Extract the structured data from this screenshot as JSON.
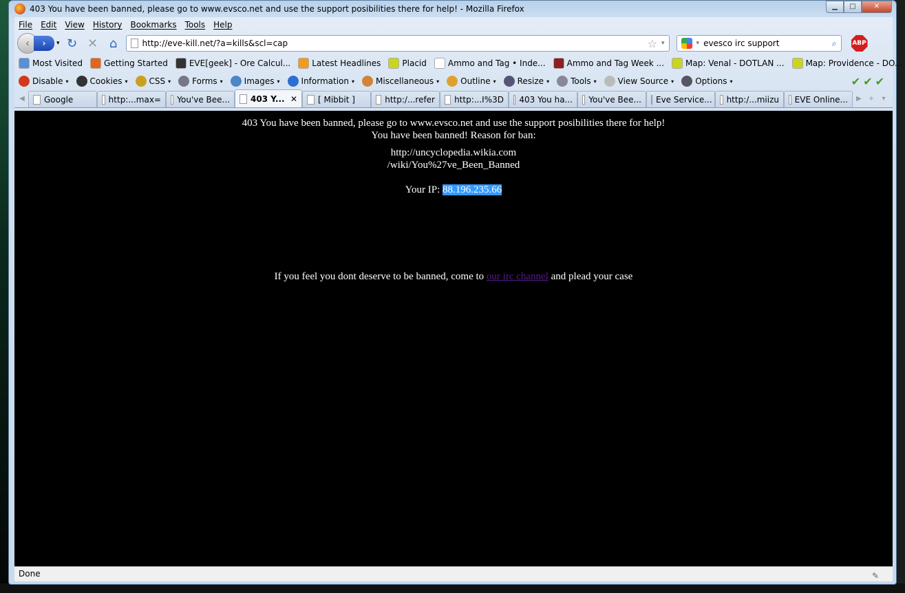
{
  "window": {
    "title": "403 You have been banned, please go to www.evsco.net and use the support posibilities there for help! - Mozilla Firefox"
  },
  "menu": [
    "File",
    "Edit",
    "View",
    "History",
    "Bookmarks",
    "Tools",
    "Help"
  ],
  "nav": {
    "url": "http://eve-kill.net/?a=kills&scl=cap",
    "search_value": "evesco irc support",
    "abp": "ABP"
  },
  "bookmarks": [
    {
      "label": "Most Visited",
      "icon": "search-page-icon",
      "color": "#5a8fd8"
    },
    {
      "label": "Getting Started",
      "icon": "firefox-icon",
      "color": "#e2651c"
    },
    {
      "label": "EVE[geek] - Ore Calcul...",
      "icon": "menu-lines-icon",
      "color": "#333"
    },
    {
      "label": "Latest Headlines",
      "icon": "rss-icon",
      "color": "#f29c1e"
    },
    {
      "label": "Placid",
      "icon": "dotlan-icon",
      "color": "#c8d61e"
    },
    {
      "label": "Ammo and Tag • Inde...",
      "icon": "page-icon",
      "color": "#fff"
    },
    {
      "label": "Ammo and Tag Week ...",
      "icon": "eve-icon",
      "color": "#8a2020"
    },
    {
      "label": "Map: Venal - DOTLAN ...",
      "icon": "dotlan-icon",
      "color": "#c8d61e"
    },
    {
      "label": "Map: Providence - DO...",
      "icon": "dotlan-icon",
      "color": "#c8d61e"
    }
  ],
  "bookmarks_overflow": "»",
  "devtools": [
    {
      "label": "Disable",
      "icon": "disable-icon",
      "color": "#d13b1b"
    },
    {
      "label": "Cookies",
      "icon": "user-icon",
      "color": "#333"
    },
    {
      "label": "CSS",
      "icon": "wand-icon",
      "color": "#c9a11e"
    },
    {
      "label": "Forms",
      "icon": "form-icon",
      "color": "#778"
    },
    {
      "label": "Images",
      "icon": "image-icon",
      "color": "#4a86c8"
    },
    {
      "label": "Information",
      "icon": "info-icon",
      "color": "#2a6fd1"
    },
    {
      "label": "Miscellaneous",
      "icon": "toolbox-icon",
      "color": "#d0843a"
    },
    {
      "label": "Outline",
      "icon": "pencil-icon",
      "color": "#e0a030"
    },
    {
      "label": "Resize",
      "icon": "resize-icon",
      "color": "#557"
    },
    {
      "label": "Tools",
      "icon": "tools-icon",
      "color": "#889"
    },
    {
      "label": "View Source",
      "icon": "source-icon",
      "color": "#bbb"
    },
    {
      "label": "Options",
      "icon": "options-icon",
      "color": "#556"
    }
  ],
  "devtools_checks": "✔✔✔",
  "tabs": [
    {
      "label": "Google",
      "icon": "google-icon",
      "active": false
    },
    {
      "label": "http:...max=",
      "icon": "page-icon",
      "active": false
    },
    {
      "label": "You've Bee...",
      "icon": "uncyclopedia-icon",
      "active": false
    },
    {
      "label": "403 Y...",
      "icon": "page-icon",
      "active": true
    },
    {
      "label": "[ Mibbit ]",
      "icon": "mibbit-icon",
      "active": false
    },
    {
      "label": "http:/...refer",
      "icon": "page-icon",
      "active": false
    },
    {
      "label": "http:...I%3D",
      "icon": "page-icon",
      "active": false
    },
    {
      "label": "403 You ha...",
      "icon": "page-icon",
      "active": false
    },
    {
      "label": "You've Bee...",
      "icon": "uncyclopedia-icon",
      "active": false
    },
    {
      "label": "Eve Service...",
      "icon": "menu-lines-icon",
      "active": false
    },
    {
      "label": "http:/...miizu",
      "icon": "page-icon",
      "active": false
    },
    {
      "label": "EVE Online...",
      "icon": "menu-lines-icon",
      "active": false
    }
  ],
  "page": {
    "heading": "403 You have been banned, please go to www.evsco.net and use the support posibilities there for help!",
    "reason_label": "You have been banned! Reason for ban:",
    "reason_line1": "http://uncyclopedia.wikia.com",
    "reason_line2": "/wiki/You%27ve_Been_Banned",
    "ip_label": "Your IP:",
    "ip_value": "88.196.235.66",
    "plead_before": "If you feel you dont deserve to be banned, come to",
    "plead_link": "our irc channel",
    "plead_after": "and plead your case"
  },
  "status": {
    "text": "Done"
  }
}
